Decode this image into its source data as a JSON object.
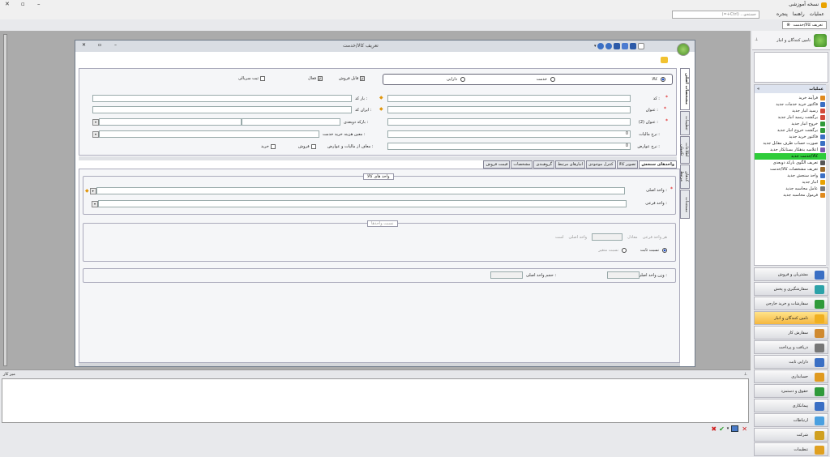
{
  "app": {
    "title": "نسخه آموزشی"
  },
  "menu": {
    "items": [
      "عملیات",
      "راهنما",
      "پنجره"
    ],
    "search_placeholder": "جستجو... (Ctrl+=)"
  },
  "doc_tab": {
    "label": "تعریف کالا/خدمت"
  },
  "window": {
    "title": "تعریف کالا/خدمت"
  },
  "form": {
    "type_options": [
      "کالا",
      "خدمت",
      "دارایی"
    ],
    "type_selected": "کالا",
    "checks": [
      {
        "label": "فعال",
        "checked": true
      },
      {
        "label": "قابل فروش",
        "checked": true
      },
      {
        "label": "ثبت سریالی",
        "checked": false
      }
    ],
    "code_label": "کد :",
    "title_label": "عنوان :",
    "title2_label": "عنوان (2) :",
    "tax_rate_label": "نرخ مالیات :",
    "duty_rate_label": "نرخ عوارض :",
    "barcode_label": "بار کد :",
    "iran_code_label": "ایران کد :",
    "barcode2_label": "بارکد دوبعدی :",
    "cost_label": "معین هزینه خرید خدمت :",
    "exempt_label": "معاف از مالیات و عوارض :",
    "exempt_sale": "فروش",
    "exempt_buy": "خرید",
    "tax_rate": "0",
    "duty_rate": "0"
  },
  "vtabs": [
    "مشخصات اصلی",
    "تنظیمات",
    "اطلاعات تکمیلی",
    "کدهای مرتبط",
    "مستندات"
  ],
  "htabs": [
    "واحدهای سنجش",
    "تصویر کالا",
    "کنترل موجودی",
    "انبارهای مرتبط",
    "گروهبندی",
    "مشخصات",
    "قیمت فروش"
  ],
  "units": {
    "group_title": "واحد های کالا",
    "main_unit_label": "واحد اصلی :",
    "sub_unit_label": "واحد فرعی :"
  },
  "ratio": {
    "group_title": "نسبت واحدها",
    "line": [
      "هر واحد فرعی",
      "معادل",
      "واحد اصلی",
      "است"
    ],
    "fixed": "نسبت ثابت",
    "variable": "نسبت متغیر"
  },
  "weight": {
    "label": "وزن واحد اصلی :",
    "volume_label": "حجم واحد اصلی :"
  },
  "bottom_panel": {
    "title": "میز کار"
  },
  "sidebar": {
    "header": "تامین کنندگان و انبار",
    "list_title": "عملیات",
    "items": [
      "فرآیند خرید",
      "فاکتور خرید خدمات جدید",
      "رسید انبار جدید",
      "برگشت رسید انبار جدید",
      "خروج انبار جدید",
      "برگشت خروج انبار جدید",
      "فاکتور خرید جدید",
      "صورت حساب طرف مقابل جدید",
      "اعلامیه بدهکار بستانکار جدید",
      "کالا/خدمت جدید",
      "تعریف الگوی بارکد دوبعدی",
      "تعریف مشخصات کالا/خدمت",
      "واحد سنجش جدید",
      "انبار جدید",
      "عامل محاسبه جدید",
      "فرمول محاسبه جدید"
    ],
    "selected_index": 9,
    "sections": [
      "مشتریان و فروش",
      "سفارشگیری و پخش",
      "سفارشات و خرید خارجی",
      "تامین کنندگان و انبار",
      "سفارش کار",
      "دریافت و پرداخت",
      "دارایی ثابت",
      "حسابداری",
      "حقوق و دستمزد",
      "پیمانکاری",
      "ارتباطات",
      "شرکت",
      "تنظیمات"
    ],
    "active_section": 3
  }
}
